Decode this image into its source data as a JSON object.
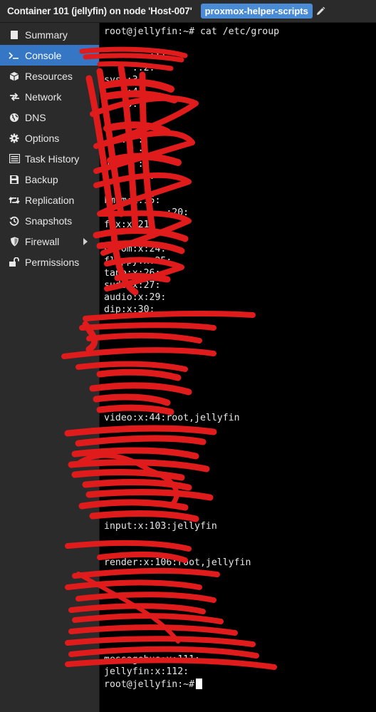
{
  "header": {
    "title": "Container 101 (jellyfin) on node 'Host-007'",
    "tag": "proxmox-helper-scripts",
    "edit_icon": "pencil-icon"
  },
  "sidebar": {
    "items": [
      {
        "label": "Summary",
        "icon": "book-icon",
        "active": false
      },
      {
        "label": "Console",
        "icon": "terminal-icon",
        "active": true
      },
      {
        "label": "Resources",
        "icon": "cube-icon",
        "active": false
      },
      {
        "label": "Network",
        "icon": "network-icon",
        "active": false
      },
      {
        "label": "DNS",
        "icon": "globe-icon",
        "active": false
      },
      {
        "label": "Options",
        "icon": "gear-icon",
        "active": false
      },
      {
        "label": "Task History",
        "icon": "list-icon",
        "active": false
      },
      {
        "label": "Backup",
        "icon": "floppy-icon",
        "active": false
      },
      {
        "label": "Replication",
        "icon": "retweet-icon",
        "active": false
      },
      {
        "label": "Snapshots",
        "icon": "history-icon",
        "active": false
      },
      {
        "label": "Firewall",
        "icon": "shield-icon",
        "active": false,
        "expandable": true
      },
      {
        "label": "Permissions",
        "icon": "unlock-icon",
        "active": false
      }
    ],
    "active_color": "#3577c4"
  },
  "console": {
    "prompt": "root@jellyfin:~#",
    "lines": [
      "root@jellyfin:~# cat /etc/group",
      "",
      "        ::1:",
      "     ::2:",
      "sys::3:",
      "    :4:",
      "    5:",
      "      :",
      "",
      "   :  :",
      "      :",
      "u     :",
      "        :",
      "       :",
      "kmem:x:15:",
      "        :  :20:",
      "fax:x:21:",
      "",
      "cdrom:x:24:",
      "floppy:x:25:",
      "tape:x:26:",
      "sudo:x:27:",
      "audio:x:29:",
      "dip:x:30:",
      "",
      "",
      "",
      "",
      "",
      "",
      "",
      "",
      "video:x:44:root,jellyfin",
      "",
      "",
      "",
      "",
      "",
      "",
      "",
      "",
      "input:x:103:jellyfin",
      "",
      "",
      "render:x:106:root,jellyfin",
      "",
      "",
      "",
      "",
      "",
      "",
      "",
      "messagebus:x:111:",
      "jellyfin:x:112:",
      "root@jellyfin:~#"
    ],
    "redaction_color": "#e01b1b"
  }
}
